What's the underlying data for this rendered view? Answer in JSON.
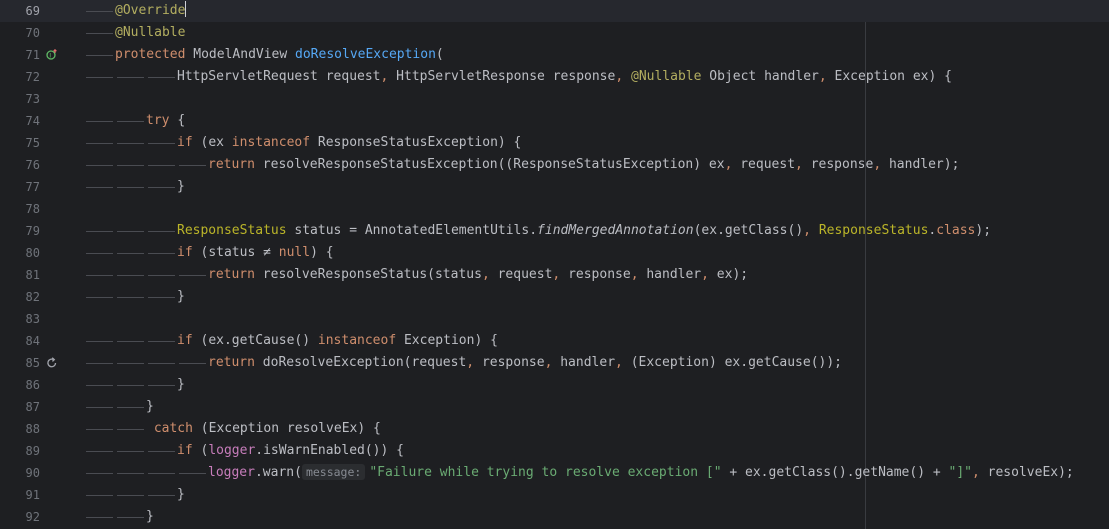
{
  "editor": {
    "lines": [
      {
        "n": "69",
        "guides": 1,
        "indent": 0,
        "current": true,
        "tokens": [
          [
            "ann",
            "@Override"
          ]
        ],
        "cursor": true
      },
      {
        "n": "70",
        "guides": 1,
        "indent": 0,
        "tokens": [
          [
            "ann",
            "@Nullable"
          ]
        ]
      },
      {
        "n": "71",
        "guides": 1,
        "indent": 0,
        "icon": "override-up-icon",
        "tokens": [
          [
            "kw",
            "protected "
          ],
          [
            "type",
            "ModelAndView "
          ],
          [
            "fn",
            "doResolveException"
          ],
          [
            "punc",
            "("
          ]
        ]
      },
      {
        "n": "72",
        "guides": 3,
        "indent": 2,
        "tokens": [
          [
            "type",
            "HttpServletRequest "
          ],
          [
            "param",
            "request"
          ],
          [
            "comma",
            ", "
          ],
          [
            "type",
            "HttpServletResponse "
          ],
          [
            "param",
            "response"
          ],
          [
            "comma",
            ", "
          ],
          [
            "ann",
            "@Nullable "
          ],
          [
            "type",
            "Object "
          ],
          [
            "param",
            "handler"
          ],
          [
            "comma",
            ", "
          ],
          [
            "type",
            "Exception "
          ],
          [
            "param",
            "ex"
          ],
          [
            "punc",
            ") {"
          ]
        ]
      },
      {
        "n": "73",
        "guides": 0,
        "indent": 0,
        "tokens": []
      },
      {
        "n": "74",
        "guides": 2,
        "indent": 1,
        "tokens": [
          [
            "kw",
            "try "
          ],
          [
            "punc",
            "{"
          ]
        ]
      },
      {
        "n": "75",
        "guides": 3,
        "indent": 2,
        "tokens": [
          [
            "kw",
            "if "
          ],
          [
            "punc",
            "("
          ],
          [
            "plain",
            "ex "
          ],
          [
            "kw",
            "instanceof "
          ],
          [
            "type",
            "ResponseStatusException"
          ],
          [
            "punc",
            ") {"
          ]
        ]
      },
      {
        "n": "76",
        "guides": 4,
        "indent": 3,
        "tokens": [
          [
            "kw",
            "return "
          ],
          [
            "plain",
            "resolveResponseStatusException((ResponseStatusException) ex"
          ],
          [
            "comma",
            ", "
          ],
          [
            "plain",
            "request"
          ],
          [
            "comma",
            ", "
          ],
          [
            "plain",
            "response"
          ],
          [
            "comma",
            ", "
          ],
          [
            "plain",
            "handler);"
          ]
        ]
      },
      {
        "n": "77",
        "guides": 3,
        "indent": 2,
        "tokens": [
          [
            "punc",
            "}"
          ]
        ]
      },
      {
        "n": "78",
        "guides": 0,
        "indent": 0,
        "tokens": []
      },
      {
        "n": "79",
        "guides": 3,
        "indent": 2,
        "tokens": [
          [
            "cls",
            "ResponseStatus "
          ],
          [
            "plain",
            "status = AnnotatedElementUtils."
          ],
          [
            "static",
            "findMergedAnnotation"
          ],
          [
            "plain",
            "(ex.getClass()"
          ],
          [
            "comma",
            ", "
          ],
          [
            "cls",
            "ResponseStatus"
          ],
          [
            "plain",
            "."
          ],
          [
            "kw",
            "class"
          ],
          [
            "plain",
            ");"
          ]
        ]
      },
      {
        "n": "80",
        "guides": 3,
        "indent": 2,
        "tokens": [
          [
            "kw",
            "if "
          ],
          [
            "punc",
            "("
          ],
          [
            "plain",
            "status ≠ "
          ],
          [
            "kw",
            "null"
          ],
          [
            "punc",
            ") {"
          ]
        ]
      },
      {
        "n": "81",
        "guides": 4,
        "indent": 3,
        "tokens": [
          [
            "kw",
            "return "
          ],
          [
            "plain",
            "resolveResponseStatus(status"
          ],
          [
            "comma",
            ", "
          ],
          [
            "plain",
            "request"
          ],
          [
            "comma",
            ", "
          ],
          [
            "plain",
            "response"
          ],
          [
            "comma",
            ", "
          ],
          [
            "plain",
            "handler"
          ],
          [
            "comma",
            ", "
          ],
          [
            "plain",
            "ex);"
          ]
        ]
      },
      {
        "n": "82",
        "guides": 3,
        "indent": 2,
        "tokens": [
          [
            "punc",
            "}"
          ]
        ]
      },
      {
        "n": "83",
        "guides": 0,
        "indent": 0,
        "tokens": []
      },
      {
        "n": "84",
        "guides": 3,
        "indent": 2,
        "tokens": [
          [
            "kw",
            "if "
          ],
          [
            "punc",
            "("
          ],
          [
            "plain",
            "ex.getCause() "
          ],
          [
            "kw",
            "instanceof "
          ],
          [
            "type",
            "Exception"
          ],
          [
            "punc",
            ") {"
          ]
        ]
      },
      {
        "n": "85",
        "guides": 4,
        "indent": 3,
        "icon": "recursive-call-icon",
        "tokens": [
          [
            "kw",
            "return "
          ],
          [
            "plain",
            "doResolveException(request"
          ],
          [
            "comma",
            ", "
          ],
          [
            "plain",
            "response"
          ],
          [
            "comma",
            ", "
          ],
          [
            "plain",
            "handler"
          ],
          [
            "comma",
            ", "
          ],
          [
            "plain",
            "(Exception) ex.getCause());"
          ]
        ]
      },
      {
        "n": "86",
        "guides": 3,
        "indent": 2,
        "tokens": [
          [
            "punc",
            "}"
          ]
        ]
      },
      {
        "n": "87",
        "guides": 2,
        "indent": 1,
        "tokens": [
          [
            "punc",
            "}"
          ]
        ]
      },
      {
        "n": "88",
        "guides": 2,
        "indent": 1,
        "tokens": [
          [
            "kw",
            " catch "
          ],
          [
            "punc",
            "("
          ],
          [
            "type",
            "Exception "
          ],
          [
            "plain",
            "resolveEx"
          ],
          [
            "punc",
            ") {"
          ]
        ]
      },
      {
        "n": "89",
        "guides": 3,
        "indent": 2,
        "tokens": [
          [
            "kw",
            "if "
          ],
          [
            "punc",
            "("
          ],
          [
            "field",
            "logger"
          ],
          [
            "plain",
            ".isWarnEnabled()) {"
          ]
        ]
      },
      {
        "n": "90",
        "guides": 4,
        "indent": 3,
        "tokens": [
          [
            "field",
            "logger"
          ],
          [
            "plain",
            ".warn("
          ],
          [
            "hint",
            "message:"
          ],
          [
            "str",
            "\"Failure while trying to resolve exception [\""
          ],
          [
            "plain",
            " + ex.getClass().getName() + "
          ],
          [
            "str",
            "\"]\""
          ],
          [
            "comma",
            ", "
          ],
          [
            "plain",
            "resolveEx);"
          ]
        ]
      },
      {
        "n": "91",
        "guides": 3,
        "indent": 2,
        "tokens": [
          [
            "punc",
            "}"
          ]
        ]
      },
      {
        "n": "92",
        "guides": 2,
        "indent": 1,
        "tokens": [
          [
            "punc",
            "}"
          ]
        ]
      }
    ]
  },
  "colors": {
    "background": "#1e1f22",
    "keyword": "#cf8e6d",
    "annotation": "#b3ae60",
    "function": "#56a8f5",
    "string": "#6aab73",
    "field": "#c77dbb"
  }
}
